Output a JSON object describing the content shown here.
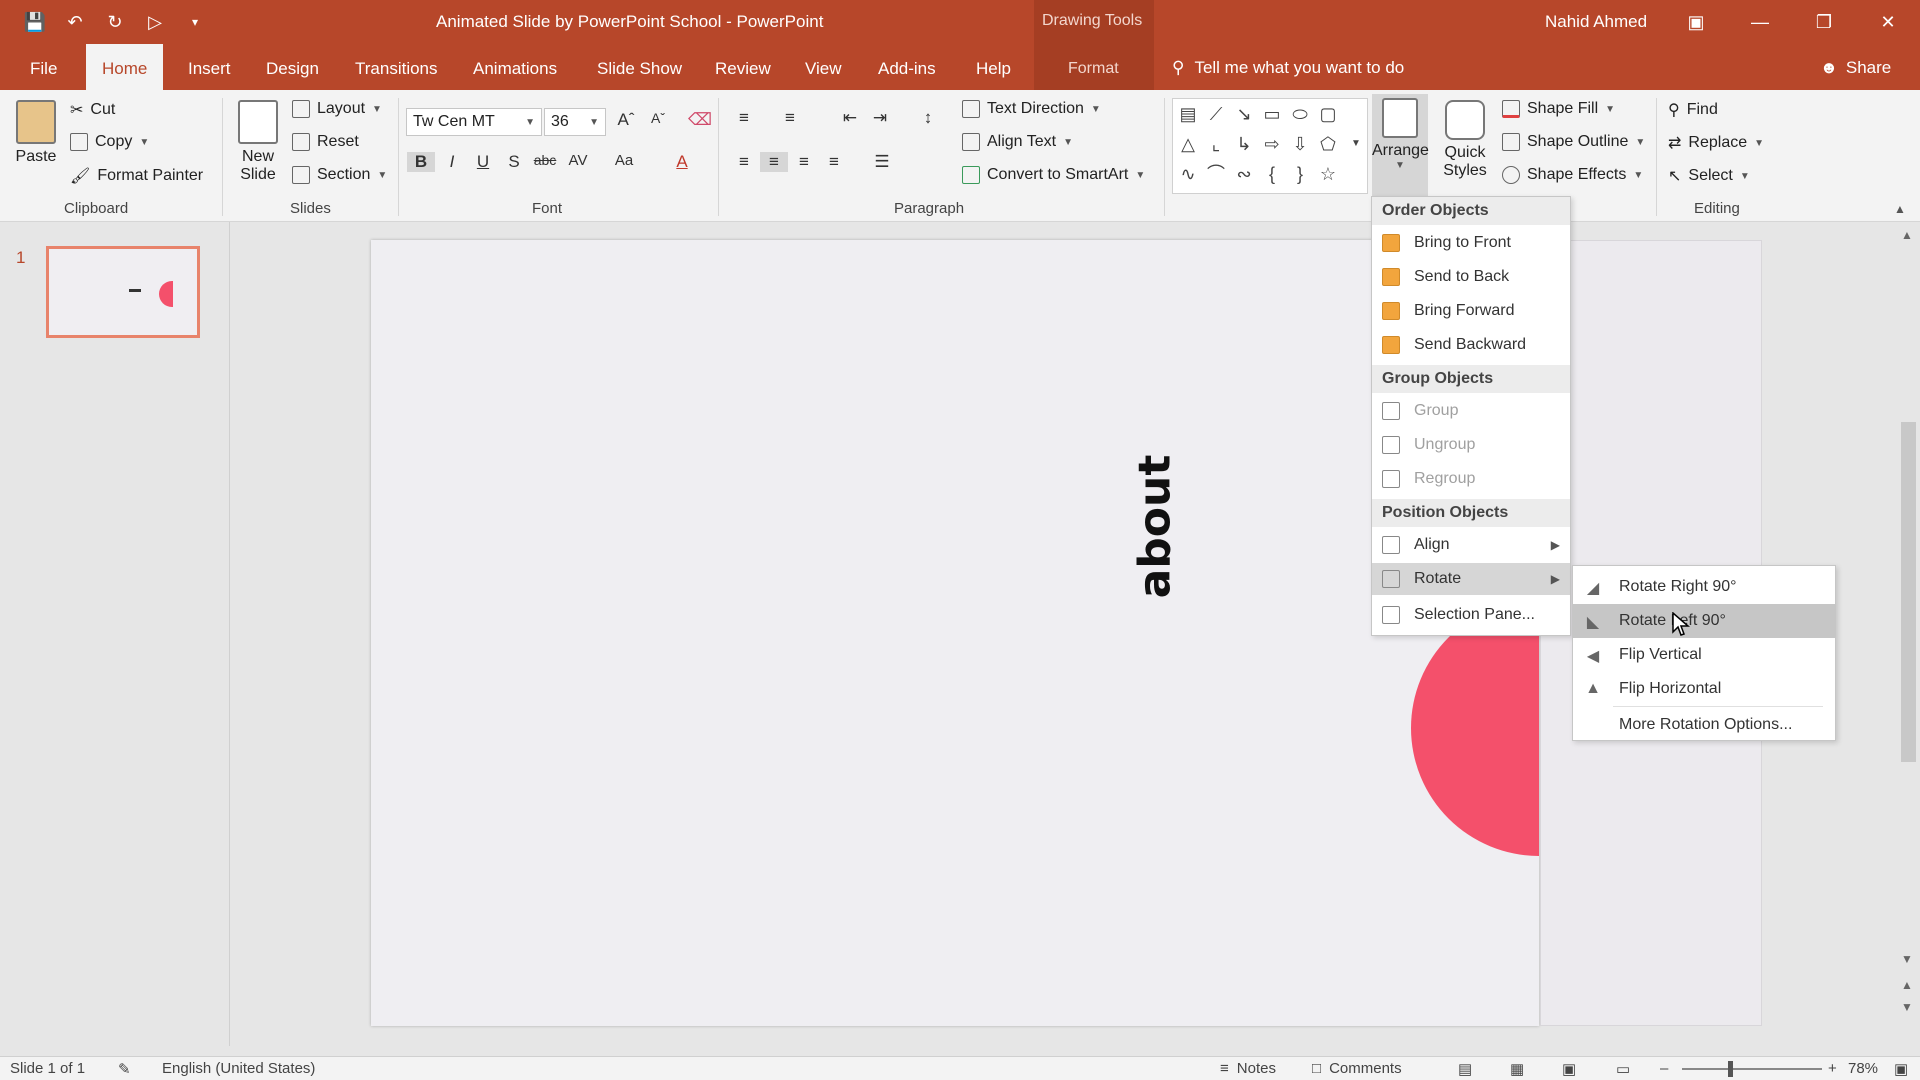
{
  "window": {
    "title": "Animated Slide by PowerPoint School  -  PowerPoint",
    "context_tab_group": "Drawing Tools",
    "user": "Nahid Ahmed"
  },
  "tabs": [
    {
      "label": "File"
    },
    {
      "label": "Home"
    },
    {
      "label": "Insert"
    },
    {
      "label": "Design"
    },
    {
      "label": "Transitions"
    },
    {
      "label": "Animations"
    },
    {
      "label": "Slide Show"
    },
    {
      "label": "Review"
    },
    {
      "label": "View"
    },
    {
      "label": "Add-ins"
    },
    {
      "label": "Help"
    },
    {
      "label": "Format"
    }
  ],
  "tell_me": "Tell me what you want to do",
  "share": "Share",
  "ribbon": {
    "clipboard": {
      "paste": "Paste",
      "cut": "Cut",
      "copy": "Copy",
      "format_painter": "Format Painter",
      "label": "Clipboard"
    },
    "slides": {
      "new_slide_line1": "New",
      "new_slide_line2": "Slide",
      "layout": "Layout",
      "reset": "Reset",
      "section": "Section",
      "label": "Slides"
    },
    "font": {
      "name": "Tw Cen MT",
      "size": "36",
      "label": "Font"
    },
    "paragraph": {
      "label": "Paragraph",
      "text_direction": "Text Direction",
      "align_text": "Align Text",
      "convert_smartart": "Convert to SmartArt"
    },
    "drawing": {
      "arrange": "Arrange",
      "quick_line1": "Quick",
      "quick_line2": "Styles",
      "shape_fill": "Shape Fill",
      "shape_outline": "Shape Outline",
      "shape_effects": "Shape Effects"
    },
    "editing": {
      "find": "Find",
      "replace": "Replace",
      "select": "Select",
      "label": "Editing"
    }
  },
  "slide_pane": {
    "number": "1"
  },
  "slide": {
    "text": "about",
    "accent_color": "#f4506b"
  },
  "arrange_menu": {
    "order_header": "Order Objects",
    "bring_to_front": "Bring to Front",
    "send_to_back": "Send to Back",
    "bring_forward": "Bring Forward",
    "send_backward": "Send Backward",
    "group_header": "Group Objects",
    "group": "Group",
    "ungroup": "Ungroup",
    "regroup": "Regroup",
    "position_header": "Position Objects",
    "align": "Align",
    "rotate": "Rotate",
    "selection_pane": "Selection Pane..."
  },
  "rotate_menu": {
    "rotate_right": "Rotate Right 90°",
    "rotate_left": "Rotate Left 90°",
    "flip_vertical": "Flip Vertical",
    "flip_horizontal": "Flip Horizontal",
    "more_options": "More Rotation Options..."
  },
  "status": {
    "slide_count": "Slide 1 of 1",
    "language": "English (United States)",
    "notes": "Notes",
    "comments": "Comments",
    "zoom": "78%"
  },
  "colors": {
    "brand": "#b7472a"
  }
}
